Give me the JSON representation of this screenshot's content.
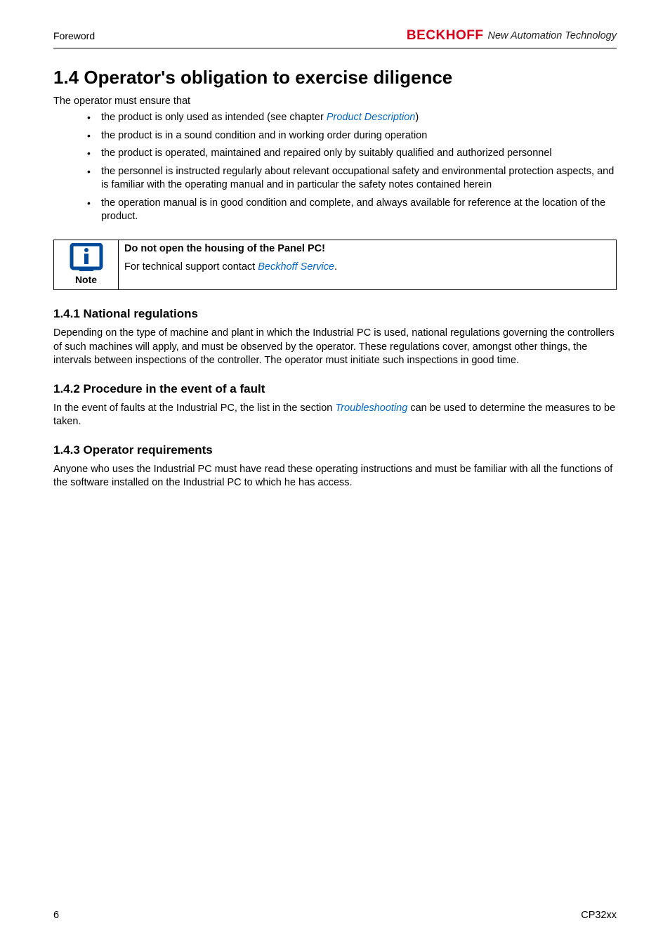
{
  "header": {
    "left": "Foreword",
    "brand": "BECKHOFF",
    "tagline": "New Automation Technology"
  },
  "section": {
    "number_title": "1.4 Operator's obligation to exercise diligence",
    "intro": "The operator must ensure that",
    "bullets": {
      "b1_prefix": "the product is only used as intended (see chapter ",
      "b1_link": "Product Description",
      "b1_suffix": ")",
      "b2": "the product is in a sound condition and in working order during operation",
      "b3": "the product is operated, maintained and repaired only by suitably qualified and authorized personnel",
      "b4": "the personnel is instructed regularly about relevant occupational safety and environmental protection aspects, and is familiar with the operating manual and in particular the safety notes contained herein",
      "b5": "the operation manual is in good condition and complete, and always available for reference at the location of the product."
    }
  },
  "note": {
    "label": "Note",
    "title": "Do not open the housing of the Panel PC!",
    "body_prefix": "For technical support contact ",
    "body_link": "Beckhoff Service",
    "body_suffix": "."
  },
  "sub1": {
    "heading": "1.4.1  National regulations",
    "para": "Depending on the type of machine and plant in which the Industrial PC is used, national regulations governing the controllers of such machines will apply, and must be observed by the operator. These regulations cover, amongst other things, the intervals between inspections of the controller. The operator must initiate such inspections in good time."
  },
  "sub2": {
    "heading": "1.4.2  Procedure in the event of a fault",
    "para_prefix": "In the event of faults at the Industrial PC, the list in the section ",
    "para_link": "Troubleshooting",
    "para_suffix": " can be used to determine the measures to be taken."
  },
  "sub3": {
    "heading": "1.4.3  Operator requirements",
    "para": "Anyone who uses the Industrial PC must have read these operating instructions and must be familiar with all the functions of the software installed on the Industrial PC to which he has access."
  },
  "footer": {
    "left": "6",
    "right": "CP32xx"
  }
}
